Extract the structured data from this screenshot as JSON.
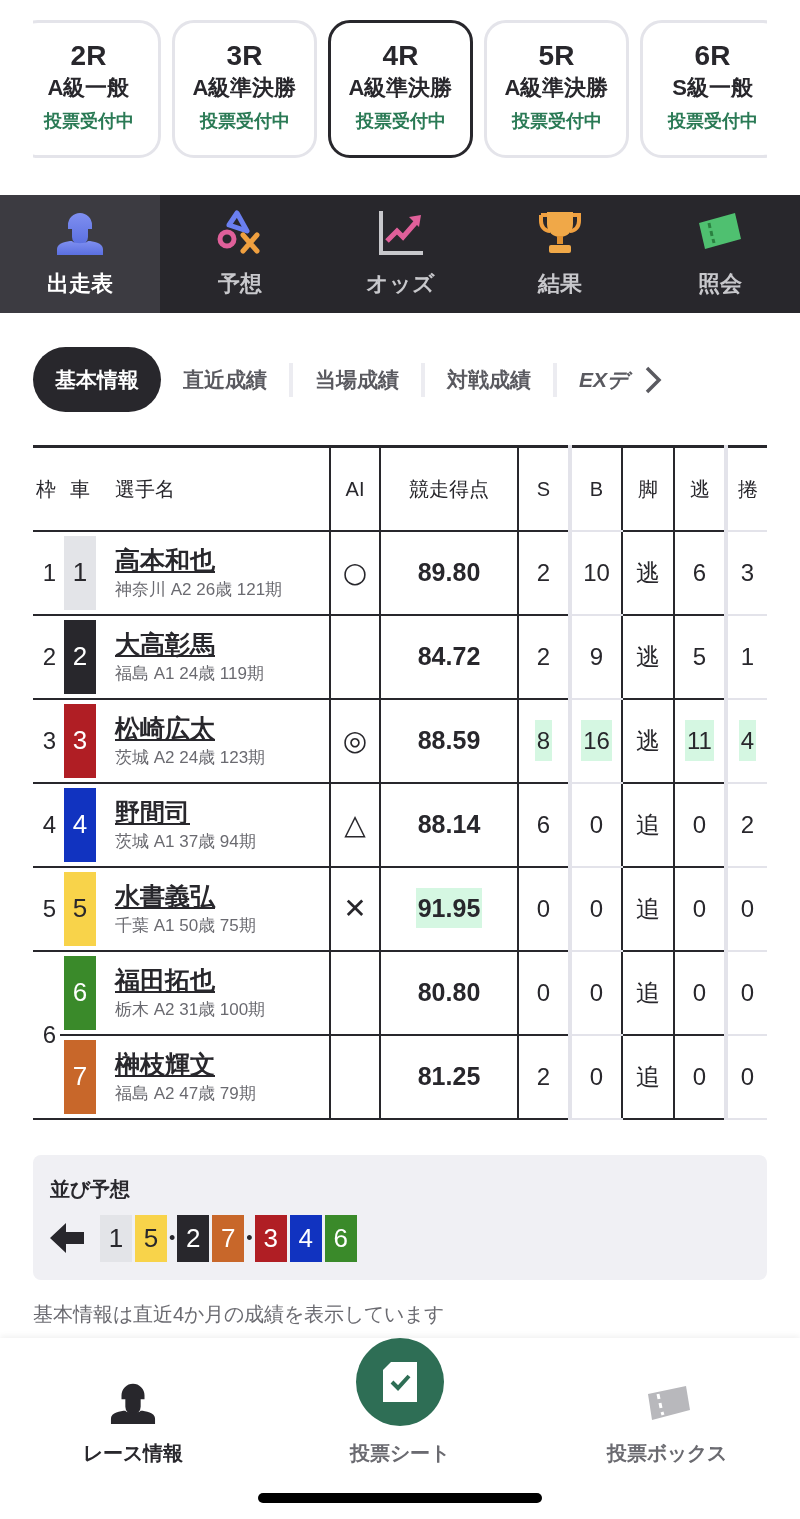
{
  "race_cards": [
    {
      "race": "2R",
      "grade": "A級一般",
      "status": "投票受付中",
      "selected": false
    },
    {
      "race": "3R",
      "grade": "A級準決勝",
      "status": "投票受付中",
      "selected": false
    },
    {
      "race": "4R",
      "grade": "A級準決勝",
      "status": "投票受付中",
      "selected": true
    },
    {
      "race": "5R",
      "grade": "A級準決勝",
      "status": "投票受付中",
      "selected": false
    },
    {
      "race": "6R",
      "grade": "S級一般",
      "status": "投票受付中",
      "selected": false
    }
  ],
  "nav_tabs": [
    {
      "label": "出走表",
      "kind": "rider",
      "selected": true
    },
    {
      "label": "予想",
      "kind": "marks",
      "selected": false
    },
    {
      "label": "オッズ",
      "kind": "chart",
      "selected": false
    },
    {
      "label": "結果",
      "kind": "trophy",
      "selected": false
    },
    {
      "label": "照会",
      "kind": "ticket",
      "selected": false
    }
  ],
  "sub_tabs": [
    {
      "label": "基本情報",
      "kind": "plain",
      "selected": true
    },
    {
      "label": "直近成績",
      "kind": "plain",
      "selected": false
    },
    {
      "label": "当場成績",
      "kind": "plain",
      "selected": false
    },
    {
      "label": "対戦成績",
      "kind": "plain",
      "selected": false
    },
    {
      "label": "EXデ",
      "kind": "italic",
      "selected": false
    }
  ],
  "table": {
    "columns": [
      "枠",
      "車",
      "選手名",
      "AI",
      "競走得点",
      "S",
      "B",
      "脚",
      "逃",
      "捲"
    ],
    "frames": [
      {
        "frame": "1",
        "riders": [
          {
            "car": "1",
            "color": "#e3e4e8",
            "name": "高本和也",
            "profile": "神奈川 A2 26歳 121期",
            "ai": "○",
            "score": {
              "text": "89.80",
              "highlight": false
            },
            "stats": [
              {
                "text": "2",
                "highlight": false
              },
              {
                "text": "10",
                "highlight": false
              },
              {
                "text": "逃",
                "highlight": false
              },
              {
                "text": "6",
                "highlight": false
              },
              {
                "text": "3",
                "highlight": false
              }
            ]
          }
        ]
      },
      {
        "frame": "2",
        "riders": [
          {
            "car": "2",
            "color": "#28272c",
            "name": "大高彰馬",
            "profile": "福島 A1 24歳 119期",
            "score": {
              "text": "84.72",
              "highlight": false
            },
            "stats": [
              {
                "text": "2",
                "highlight": false
              },
              {
                "text": "9",
                "highlight": false
              },
              {
                "text": "逃",
                "highlight": false
              },
              {
                "text": "5",
                "highlight": false
              },
              {
                "text": "1",
                "highlight": false
              }
            ]
          }
        ]
      },
      {
        "frame": "3",
        "riders": [
          {
            "car": "3",
            "color": "#b01e24",
            "name": "松崎広太",
            "profile": "茨城 A2 24歳 123期",
            "ai": "◎",
            "score": {
              "text": "88.59",
              "highlight": false
            },
            "stats": [
              {
                "text": "8",
                "highlight": true
              },
              {
                "text": "16",
                "highlight": true
              },
              {
                "text": "逃",
                "highlight": false
              },
              {
                "text": "11",
                "highlight": true
              },
              {
                "text": "4",
                "highlight": true
              }
            ]
          }
        ]
      },
      {
        "frame": "4",
        "riders": [
          {
            "car": "4",
            "color": "#1133c0",
            "name": "野間司",
            "profile": "茨城 A1 37歳 94期",
            "ai": "△",
            "score": {
              "text": "88.14",
              "highlight": false
            },
            "stats": [
              {
                "text": "6",
                "highlight": false
              },
              {
                "text": "0",
                "highlight": false
              },
              {
                "text": "追",
                "highlight": false
              },
              {
                "text": "0",
                "highlight": false
              },
              {
                "text": "2",
                "highlight": false
              }
            ]
          }
        ]
      },
      {
        "frame": "5",
        "riders": [
          {
            "car": "5",
            "color": "#f8d34a",
            "name": "水書義弘",
            "profile": "千葉 A1 50歳 75期",
            "ai": "✕",
            "score": {
              "text": "91.95",
              "highlight": true
            },
            "stats": [
              {
                "text": "0",
                "highlight": false
              },
              {
                "text": "0",
                "highlight": false
              },
              {
                "text": "追",
                "highlight": false
              },
              {
                "text": "0",
                "highlight": false
              },
              {
                "text": "0",
                "highlight": false
              }
            ]
          }
        ]
      },
      {
        "frame": "6",
        "riders": [
          {
            "car": "6",
            "color": "#3a8a2a",
            "name": "福田拓也",
            "profile": "栃木 A2 31歳 100期",
            "score": {
              "text": "80.80",
              "highlight": false
            },
            "stats": [
              {
                "text": "0",
                "highlight": false
              },
              {
                "text": "0",
                "highlight": false
              },
              {
                "text": "追",
                "highlight": false
              },
              {
                "text": "0",
                "highlight": false
              },
              {
                "text": "0",
                "highlight": false
              }
            ]
          },
          {
            "car": "7",
            "color": "#c8672a",
            "name": "榊枝輝文",
            "profile": "福島 A2 47歳 79期",
            "score": {
              "text": "81.25",
              "highlight": false
            },
            "stats": [
              {
                "text": "2",
                "highlight": false
              },
              {
                "text": "0",
                "highlight": false
              },
              {
                "text": "追",
                "highlight": false
              },
              {
                "text": "0",
                "highlight": false
              },
              {
                "text": "0",
                "highlight": false
              }
            ]
          }
        ]
      }
    ]
  },
  "line_prediction": {
    "title": "並び予想",
    "separator": "•",
    "groups": [
      [
        {
          "car": "1",
          "color": "#e3e4e8"
        },
        {
          "car": "5",
          "color": "#f8d34a"
        }
      ],
      [
        {
          "car": "2",
          "color": "#28272c"
        },
        {
          "car": "7",
          "color": "#c8672a"
        }
      ],
      [
        {
          "car": "3",
          "color": "#b01e24"
        },
        {
          "car": "4",
          "color": "#1133c0"
        },
        {
          "car": "6",
          "color": "#3a8a2a"
        }
      ]
    ]
  },
  "footnote": "基本情報は直近4か月の成績を表示しています",
  "bottom_nav": [
    {
      "label": "レース情報",
      "kind": "rider",
      "selected": true
    },
    {
      "label": "投票シート",
      "kind": "sheet",
      "selected": false
    },
    {
      "label": "投票ボックス",
      "kind": "ticket",
      "selected": false
    }
  ]
}
